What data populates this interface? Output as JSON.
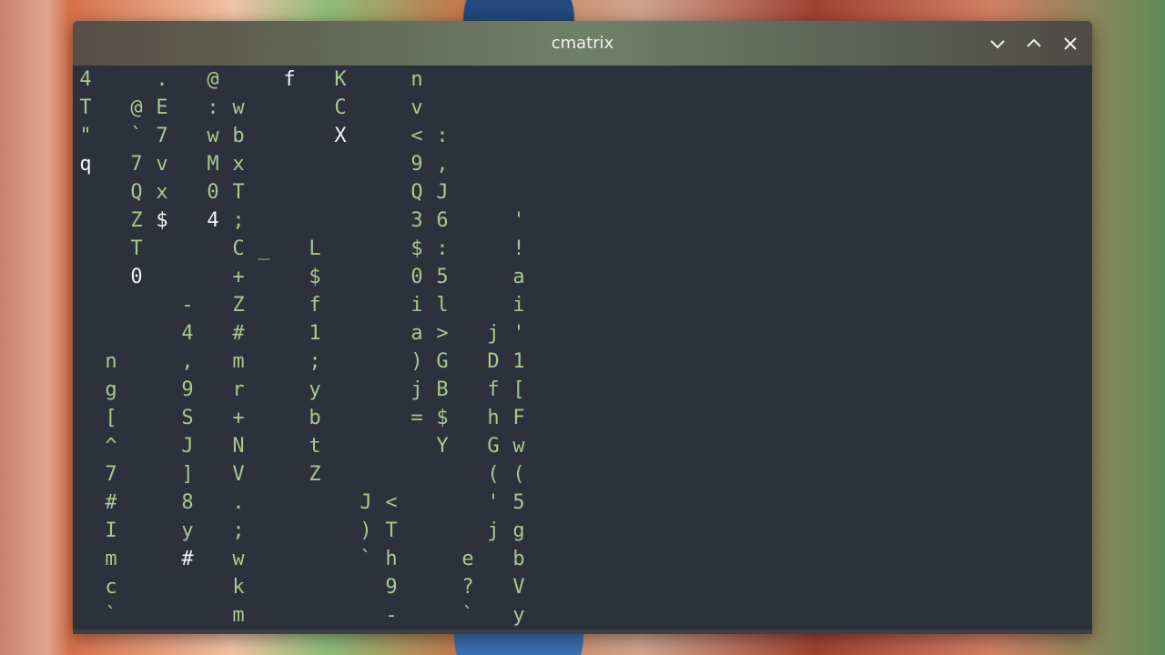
{
  "window": {
    "title": "cmatrix",
    "controls": {
      "minimize_icon": "chevron-down-icon",
      "maximize_icon": "chevron-up-icon",
      "close_icon": "close-icon"
    }
  },
  "colors": {
    "terminal_bg": "#2c313b",
    "glyph_green": "#a8c890",
    "glyph_head": "#f2f2f2",
    "title_text": "#f1f1f1"
  },
  "matrix_columns": [
    {
      "c": 0,
      "start": 0,
      "chars": "4T\"q",
      "head": 3
    },
    {
      "c": 1,
      "start": 10,
      "chars": "ng[^7#Imc`",
      "head": -1
    },
    {
      "c": 2,
      "start": 1,
      "chars": "@`7QZT0",
      "head": 6
    },
    {
      "c": 3,
      "start": 0,
      "chars": ".E7vx$",
      "head": 5
    },
    {
      "c": 4,
      "start": 8,
      "chars": "-4,9SJ]8y#",
      "head": 9
    },
    {
      "c": 5,
      "start": 0,
      "chars": "@:wM04",
      "head": 5
    },
    {
      "c": 6,
      "start": 1,
      "chars": "wbxT;C+Z#mr+NV.;wkm",
      "head": -1
    },
    {
      "c": 7,
      "start": 6,
      "chars": "_",
      "head": -1
    },
    {
      "c": 8,
      "start": 0,
      "chars": "f",
      "head": 0
    },
    {
      "c": 9,
      "start": 6,
      "chars": "L$f1;ybtZ",
      "head": 14
    },
    {
      "c": 10,
      "start": 0,
      "chars": "KCX",
      "head": 2
    },
    {
      "c": 11,
      "start": 15,
      "chars": "J)`",
      "head": -1
    },
    {
      "c": 12,
      "start": 15,
      "chars": "<Th9-",
      "head": -1
    },
    {
      "c": 13,
      "start": 0,
      "chars": "nv<9Q3$0ia)j=",
      "head": -1
    },
    {
      "c": 14,
      "start": 2,
      "chars": ":,J6:5l>GB$Y",
      "head": 13
    },
    {
      "c": 15,
      "start": 17,
      "chars": "e?`U",
      "head": -1
    },
    {
      "c": 16,
      "start": 9,
      "chars": "jDfhG('j",
      "head": -1
    },
    {
      "c": 17,
      "start": 5,
      "chars": "'!ai'1[Fw(5gbVy",
      "head": -1
    }
  ]
}
